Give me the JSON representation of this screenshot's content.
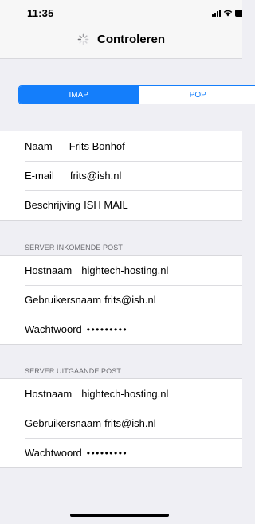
{
  "status_bar": {
    "time": "11:35",
    "icons": [
      "signal-icon",
      "wifi-icon",
      "battery-icon"
    ]
  },
  "nav": {
    "title": "Controleren",
    "activity_indicator": "spinner-icon"
  },
  "segmented_control": {
    "options": [
      "IMAP",
      "POP"
    ],
    "selected": "IMAP",
    "accent_color": "#147efb"
  },
  "account": {
    "name_label": "Naam",
    "name_value": "Frits Bonhof",
    "email_label": "E-mail",
    "email_value": "frits@ish.nl",
    "description_label": "Beschrijving",
    "description_value": "ISH MAIL"
  },
  "incoming": {
    "header": "SERVER INKOMENDE POST",
    "hostname_label": "Hostnaam",
    "hostname_value": "hightech-hosting.nl",
    "username_label": "Gebruikersnaam",
    "username_value": "frits@ish.nl",
    "password_label": "Wachtwoord",
    "password_value": "•••••••••"
  },
  "outgoing": {
    "header": "SERVER UITGAANDE POST",
    "hostname_label": "Hostnaam",
    "hostname_value": "hightech-hosting.nl",
    "username_label": "Gebruikersnaam",
    "username_value": "frits@ish.nl",
    "password_label": "Wachtwoord",
    "password_value": "•••••••••"
  }
}
